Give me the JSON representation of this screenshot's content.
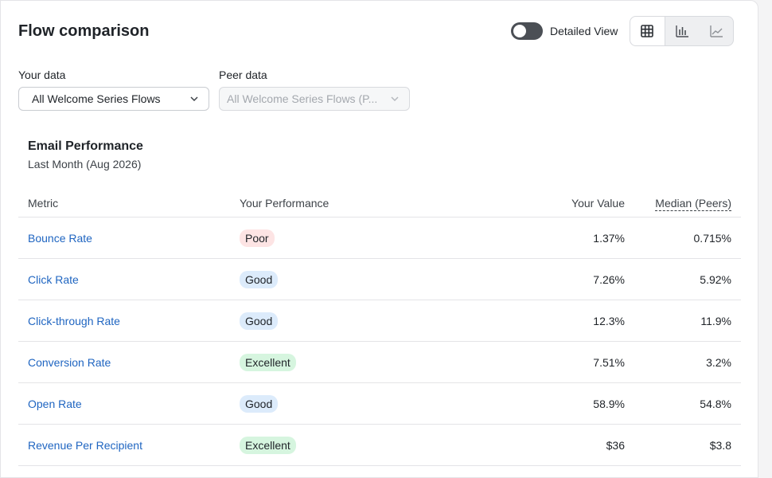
{
  "header": {
    "title": "Flow comparison",
    "toggle_label": "Detailed View",
    "toggle_on": false,
    "view_modes": [
      "table-icon",
      "bar-chart-icon",
      "line-chart-icon"
    ],
    "active_view": "table-icon"
  },
  "filters": {
    "your_data_label": "Your data",
    "your_data_value": "All Welcome Series Flows",
    "peer_data_label": "Peer data",
    "peer_data_value": "All Welcome Series Flows (P..."
  },
  "section": {
    "title": "Email Performance",
    "subtitle": "Last Month (Aug 2026)"
  },
  "table": {
    "headers": {
      "metric": "Metric",
      "performance": "Your Performance",
      "value": "Your Value",
      "median": "Median (Peers)"
    },
    "rows": [
      {
        "metric": "Bounce Rate",
        "performance": "Poor",
        "value": "1.37%",
        "median": "0.715%"
      },
      {
        "metric": "Click Rate",
        "performance": "Good",
        "value": "7.26%",
        "median": "5.92%"
      },
      {
        "metric": "Click-through Rate",
        "performance": "Good",
        "value": "12.3%",
        "median": "11.9%"
      },
      {
        "metric": "Conversion Rate",
        "performance": "Excellent",
        "value": "7.51%",
        "median": "3.2%"
      },
      {
        "metric": "Open Rate",
        "performance": "Good",
        "value": "58.9%",
        "median": "54.8%"
      },
      {
        "metric": "Revenue Per Recipient",
        "performance": "Excellent",
        "value": "$36",
        "median": "$3.8"
      }
    ]
  },
  "colors": {
    "link": "#1f65c1",
    "poor_bg": "#fde4e4",
    "good_bg": "#dcebfb",
    "excellent_bg": "#d6f5df"
  }
}
